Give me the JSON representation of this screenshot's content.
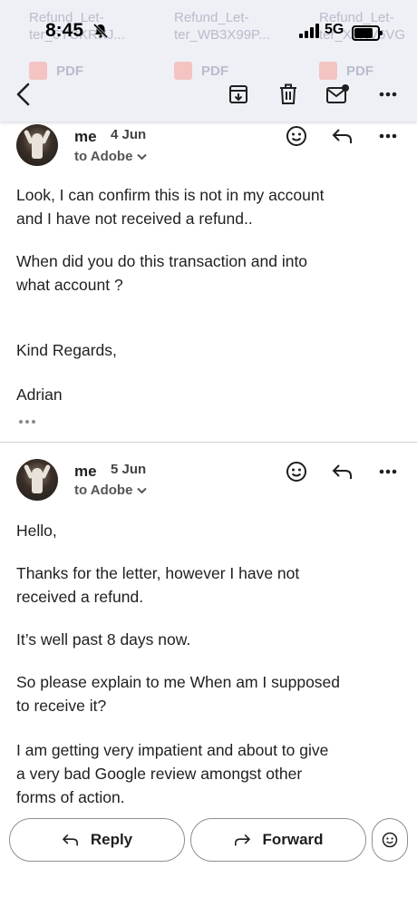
{
  "status_bar": {
    "time": "8:45",
    "network": "5G"
  },
  "attachments": [
    {
      "name_line1": "Refund_Let-",
      "name_line2": "ter_6YCKRXJ...",
      "type": "PDF"
    },
    {
      "name_line1": "Refund_Let-",
      "name_line2": "ter_WB3X99P...",
      "type": "PDF"
    },
    {
      "name_line1": "Refund_Let-",
      "name_line2": "ter_X8NV6VG",
      "type": "PDF"
    }
  ],
  "messages": [
    {
      "sender": "me",
      "date": "4 Jun",
      "recipient": "to Adobe",
      "lines": [
        "Look, I can confirm this is not in my account",
        "and I have not received a refund..",
        "When did you do this transaction and into",
        "what account ?",
        "Kind Regards,",
        "Adrian"
      ]
    },
    {
      "sender": "me",
      "date": "5 Jun",
      "recipient": "to Adobe",
      "lines": [
        "Hello,",
        "Thanks for the letter, however I have not",
        "received a refund.",
        "It’s well past 8 days now.",
        "So please explain to me When am I supposed",
        "to receive it?",
        "I am getting very impatient and about to give",
        "a very bad Google review amongst other",
        "forms of action."
      ]
    }
  ],
  "actions": {
    "reply_label": "Reply",
    "forward_label": "Forward"
  },
  "colors": {
    "toolbar_bg": "#eef0f6",
    "text": "#1f1f1f",
    "divider": "#d4d4d4"
  }
}
